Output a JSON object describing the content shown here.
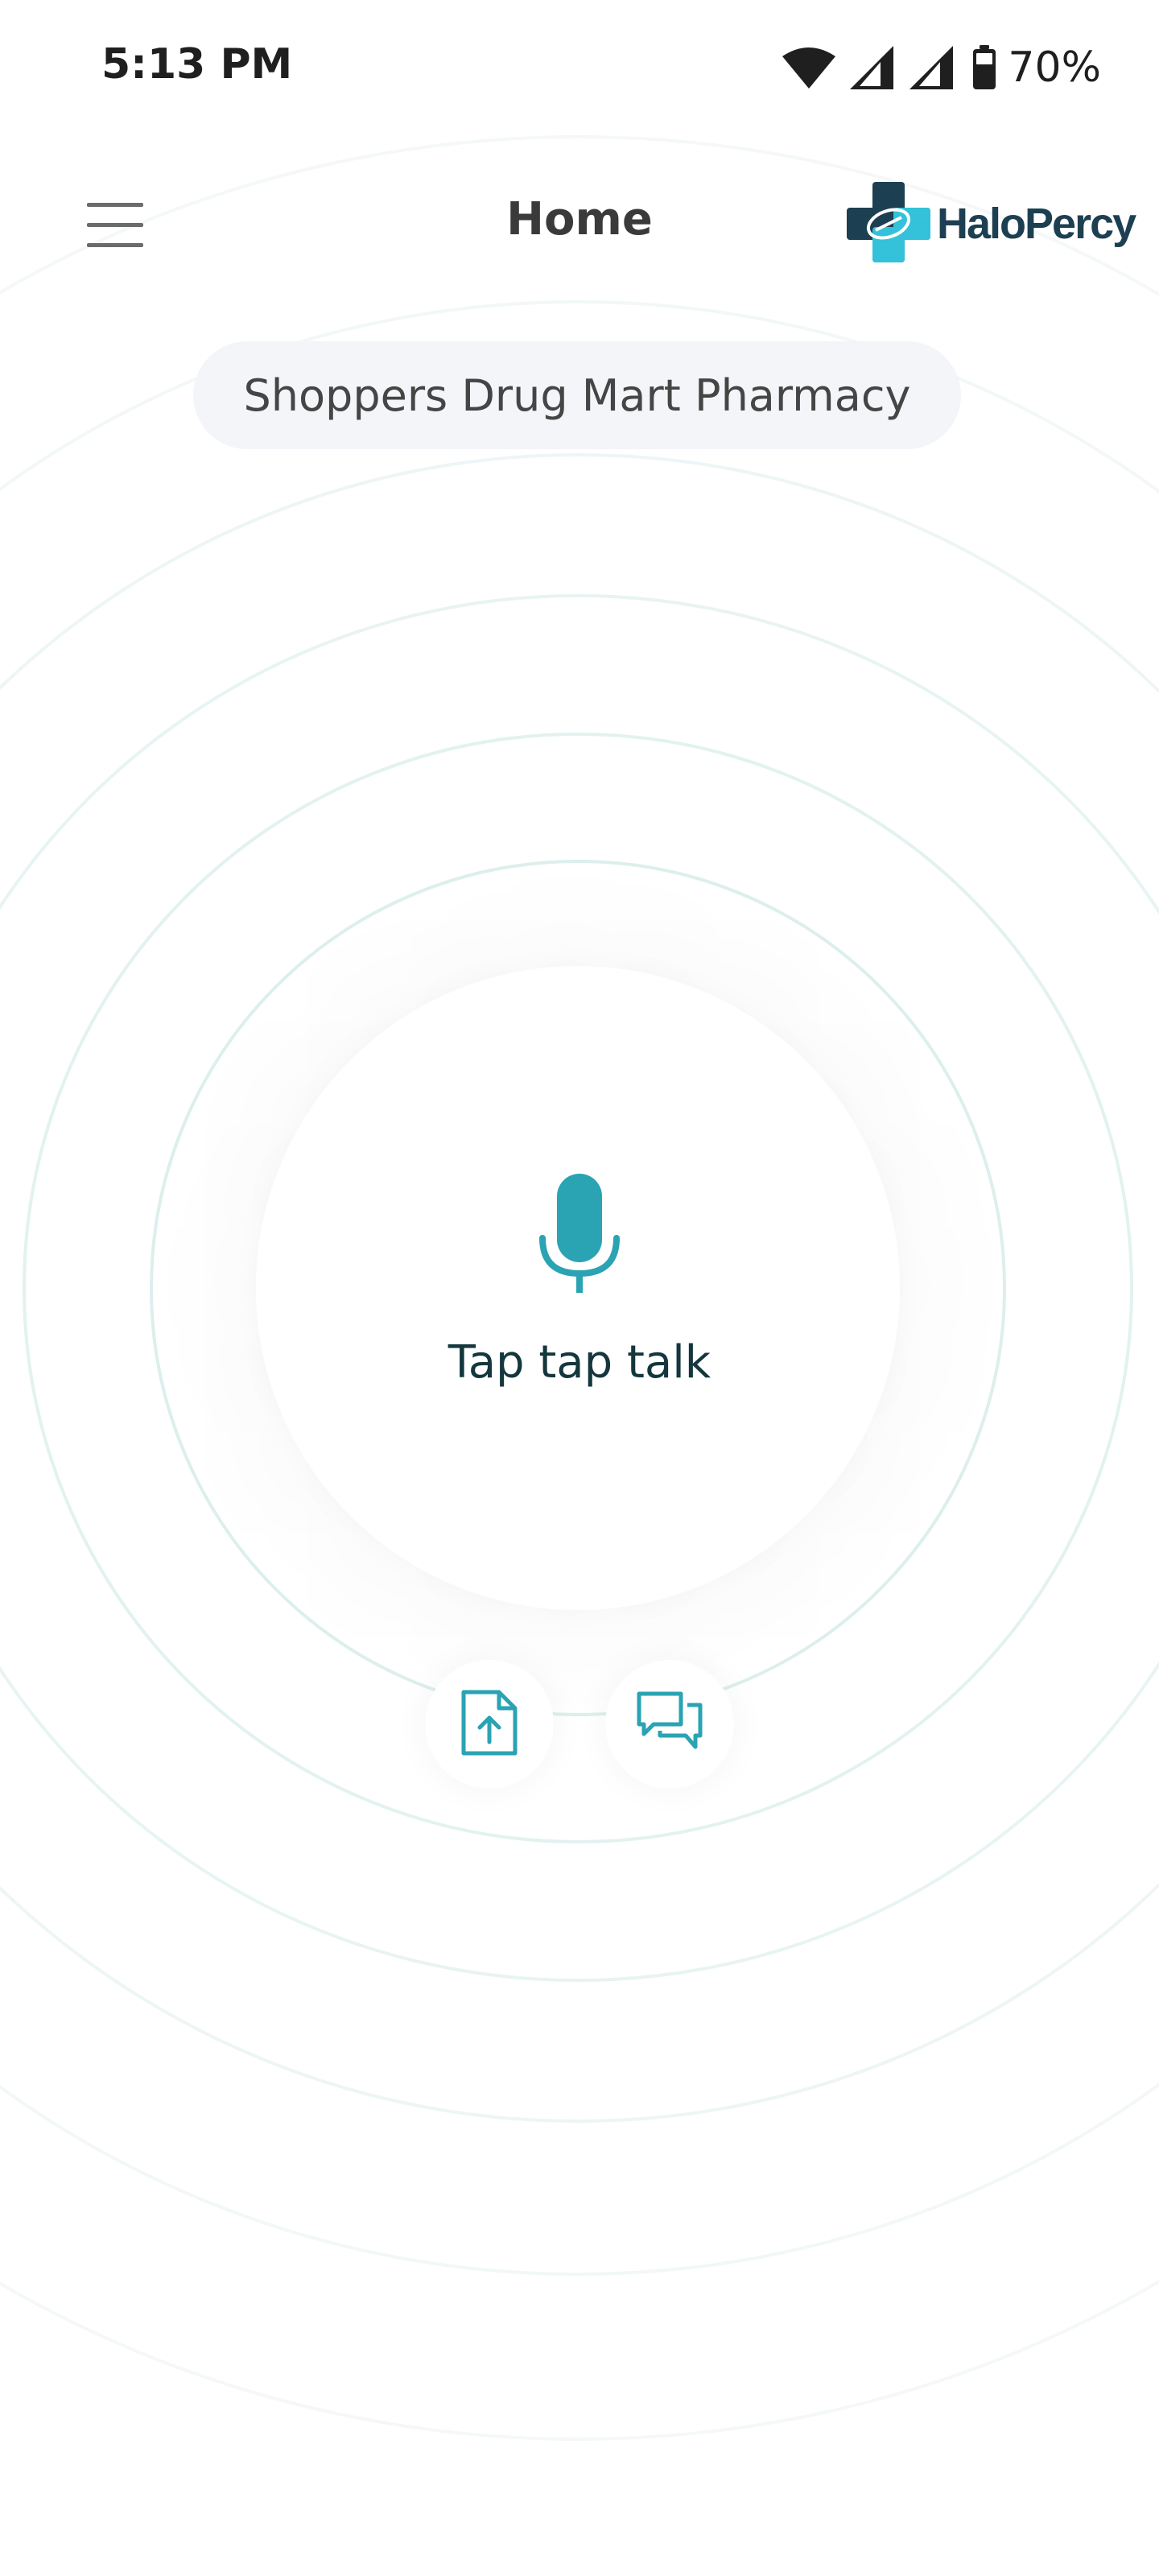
{
  "status_bar": {
    "time": "5:13 PM",
    "battery": "70%",
    "icons": [
      "wifi-icon",
      "cell-signal-icon",
      "cell-signal-icon",
      "battery-icon"
    ]
  },
  "header": {
    "menu_icon": "hamburger-menu-icon",
    "title": "Home",
    "logo_text": "HaloPercy"
  },
  "pharmacy": {
    "name": "Shoppers Drug Mart Pharmacy"
  },
  "voice": {
    "icon": "microphone-icon",
    "label": "Tap tap talk"
  },
  "actions": {
    "upload_icon": "file-upload-icon",
    "chat_icon": "chat-bubbles-icon"
  },
  "colors": {
    "accent": "#2aa3b3",
    "dark_navy": "#1d3f52",
    "pill_bg": "#f4f5f9",
    "ring": "#e3f3f1"
  }
}
